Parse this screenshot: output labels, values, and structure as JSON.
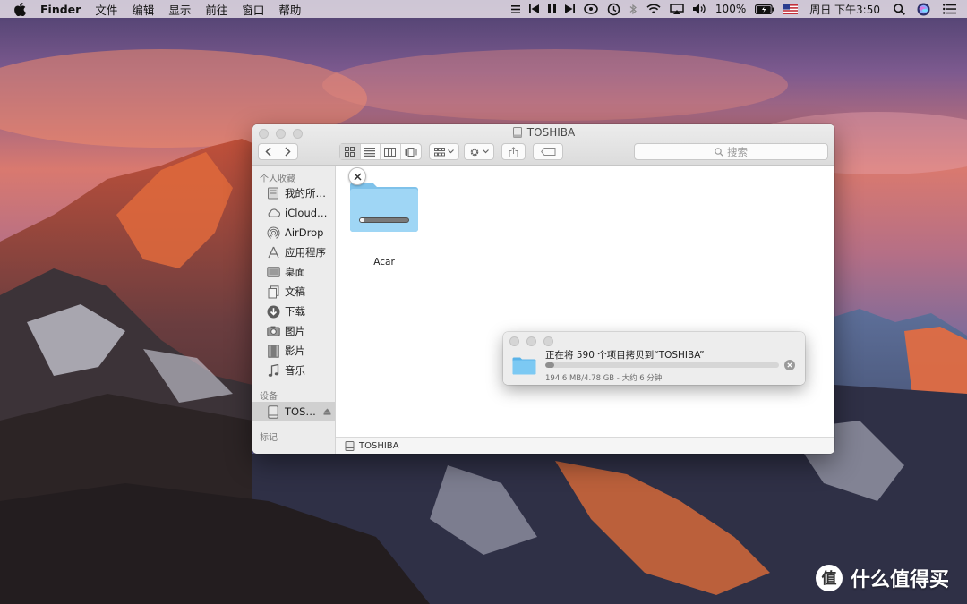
{
  "menubar": {
    "app_name": "Finder",
    "menus": [
      "文件",
      "编辑",
      "显示",
      "前往",
      "窗口",
      "帮助"
    ],
    "battery": "100%",
    "clock": "周日 下午3:50"
  },
  "finder": {
    "title": "TOSHIBA",
    "search_placeholder": "搜索",
    "sidebar": {
      "favorites_header": "个人收藏",
      "favorites": [
        {
          "label": "我的所…",
          "icon": "all-files-icon"
        },
        {
          "label": "iCloud…",
          "icon": "icloud-icon"
        },
        {
          "label": "AirDrop",
          "icon": "airdrop-icon"
        },
        {
          "label": "应用程序",
          "icon": "applications-icon"
        },
        {
          "label": "桌面",
          "icon": "desktop-icon"
        },
        {
          "label": "文稿",
          "icon": "documents-icon"
        },
        {
          "label": "下载",
          "icon": "downloads-icon"
        },
        {
          "label": "图片",
          "icon": "pictures-icon"
        },
        {
          "label": "影片",
          "icon": "movies-icon"
        },
        {
          "label": "音乐",
          "icon": "music-icon"
        }
      ],
      "devices_header": "设备",
      "devices": [
        {
          "label": "TOS…",
          "icon": "drive-icon"
        }
      ],
      "tags_header": "标记"
    },
    "items": [
      {
        "name": "Acar",
        "copy_progress": 0.1
      }
    ],
    "pathbar": "TOSHIBA"
  },
  "copy_dialog": {
    "title": "正在将 590 个项目拷贝到“TOSHIBA”",
    "progress": 0.04,
    "detail": "194.6 MB/4.78 GB - 大约 6 分钟"
  },
  "watermark": "什么值得买",
  "colors": {
    "folder": "#8fcdf0",
    "accent": "#8e8e8e"
  }
}
